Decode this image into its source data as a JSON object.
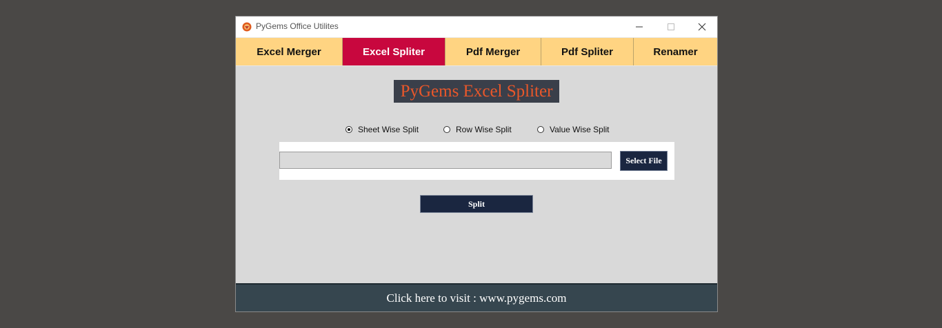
{
  "window": {
    "title": "PyGems Office Utilites",
    "icon": "pygems-logo-icon",
    "controls": [
      "minimize-icon",
      "maximize-icon",
      "close-icon"
    ]
  },
  "tabs": [
    {
      "label": "Excel Merger",
      "active": false
    },
    {
      "label": "Excel Spliter",
      "active": true
    },
    {
      "label": "Pdf Merger",
      "active": false
    },
    {
      "label": "Pdf Spliter",
      "active": false
    },
    {
      "label": "Renamer",
      "active": false
    }
  ],
  "main": {
    "heading": "PyGems Excel Spliter",
    "split_options": [
      {
        "label": "Sheet Wise Split",
        "selected": true
      },
      {
        "label": "Row Wise Split",
        "selected": false
      },
      {
        "label": "Value Wise Split",
        "selected": false
      }
    ],
    "file_path": "",
    "select_file_label": "Select File",
    "split_label": "Split"
  },
  "footer": {
    "link_text": "Click here to visit : www.pygems.com"
  },
  "colors": {
    "tab_bg": "#ffd482",
    "tab_active_bg": "#c8073e",
    "heading_bg": "#3a3f4a",
    "heading_text": "#e9572a",
    "button_bg": "#1a2640",
    "footer_bg": "#36464f"
  }
}
